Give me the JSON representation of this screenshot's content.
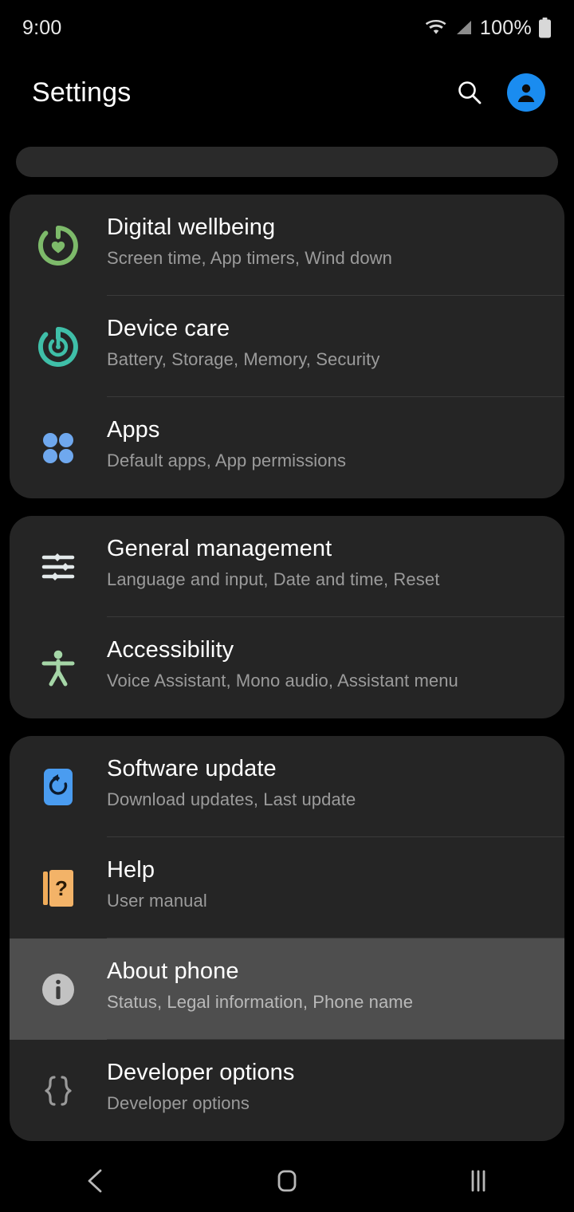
{
  "status_bar": {
    "time": "9:00",
    "battery_percent": "100%",
    "icons": [
      "wifi-icon",
      "signal-icon",
      "battery-icon"
    ]
  },
  "app_bar": {
    "title": "Settings",
    "search_icon": "search-icon",
    "account_icon": "account-avatar-icon"
  },
  "search_pill": {
    "placeholder": ""
  },
  "colors": {
    "background": "#000000",
    "card": "#252525",
    "pressed_row": "#4e4e4e",
    "divider": "#3a3a3a",
    "title_text": "#ffffff",
    "subtitle_text": "#9b9b9b",
    "accent_blue": "#1a8cf0",
    "wellbeing_green": "#7dba6a",
    "devicecare_teal": "#3fbfa8",
    "apps_blue": "#6fa8ee",
    "accessibility_green": "#a5d6a7",
    "update_blue": "#4a9cf0",
    "help_orange": "#f0ac5a",
    "info_gray": "#bdbdbd"
  },
  "sections": [
    {
      "id": "section-wellbeing",
      "items": [
        {
          "icon": "digital-wellbeing-icon",
          "title": "Digital wellbeing",
          "subtitle": "Screen time, App timers, Wind down",
          "pressed": false
        },
        {
          "icon": "device-care-icon",
          "title": "Device care",
          "subtitle": "Battery, Storage, Memory, Security",
          "pressed": false
        },
        {
          "icon": "apps-icon",
          "title": "Apps",
          "subtitle": "Default apps, App permissions",
          "pressed": false
        }
      ]
    },
    {
      "id": "section-general",
      "items": [
        {
          "icon": "sliders-icon",
          "title": "General management",
          "subtitle": "Language and input, Date and time, Reset",
          "pressed": false
        },
        {
          "icon": "accessibility-icon",
          "title": "Accessibility",
          "subtitle": "Voice Assistant, Mono audio, Assistant menu",
          "pressed": false
        }
      ]
    },
    {
      "id": "section-system",
      "items": [
        {
          "icon": "software-update-icon",
          "title": "Software update",
          "subtitle": "Download updates, Last update",
          "pressed": false
        },
        {
          "icon": "help-book-icon",
          "title": "Help",
          "subtitle": "User manual",
          "pressed": false
        },
        {
          "icon": "info-icon",
          "title": "About phone",
          "subtitle": "Status, Legal information, Phone name",
          "pressed": true
        },
        {
          "icon": "developer-braces-icon",
          "title": "Developer options",
          "subtitle": "Developer options",
          "pressed": false
        }
      ]
    }
  ],
  "nav_bar": {
    "back": "back-icon",
    "home": "home-icon",
    "recents": "recents-icon"
  }
}
